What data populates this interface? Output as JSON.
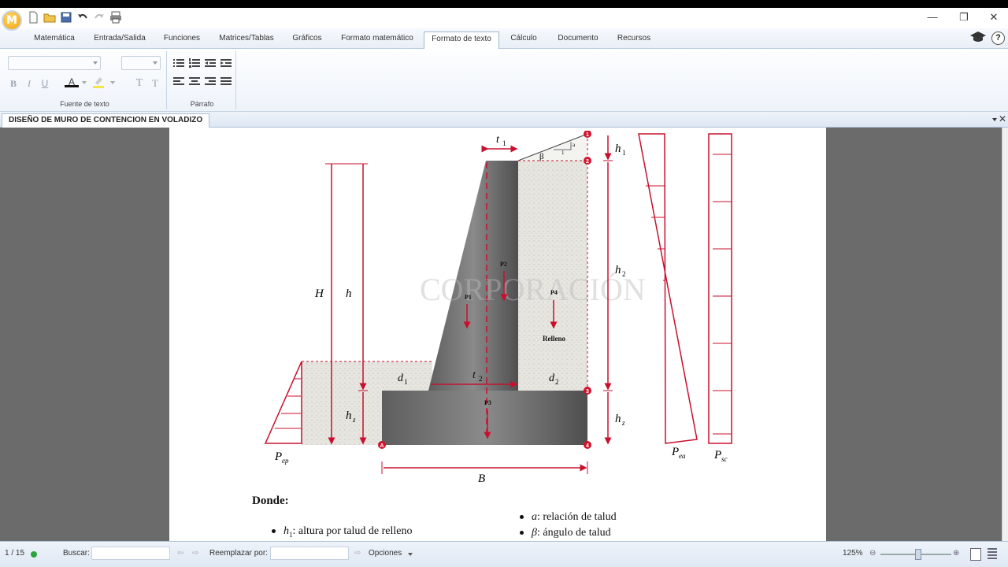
{
  "app": {
    "logo_letter": "M",
    "window_controls": [
      "—",
      "❐",
      "✕"
    ]
  },
  "ribbon_tabs": [
    {
      "label": "Matemática"
    },
    {
      "label": "Entrada/Salida"
    },
    {
      "label": "Funciones"
    },
    {
      "label": "Matrices/Tablas"
    },
    {
      "label": "Gráficos"
    },
    {
      "label": "Formato matemático"
    },
    {
      "label": "Formato de texto",
      "active": true
    },
    {
      "label": "Cálculo"
    },
    {
      "label": "Documento"
    },
    {
      "label": "Recursos"
    }
  ],
  "ribbon_groups": {
    "font": {
      "label": "Fuente de texto",
      "bold": "B",
      "italic": "I",
      "underline": "U",
      "font_color": "A",
      "t1": "T",
      "t2": "T"
    },
    "paragraph": {
      "label": "Párrafo"
    }
  },
  "help": {
    "question": "?"
  },
  "document": {
    "tab_title": "DISEÑO DE MURO DE CONTENCION EN VOLADIZO",
    "figure": {
      "labels": {
        "t1": "t",
        "t1_sub": "1",
        "t2": "t",
        "t2_sub": "2",
        "beta": "β",
        "slope_a": "a",
        "slope_1": "1",
        "H": "H",
        "h": "h",
        "h1": "h",
        "h1_sub": "1",
        "h2": "h",
        "h2_sub": "2",
        "hz_left": "h",
        "hz_left_sub": "z",
        "hz_right": "h",
        "hz_right_sub": "z",
        "d1": "d",
        "d1_sub": "1",
        "d2": "d",
        "d2_sub": "2",
        "B": "B",
        "P1": "P1",
        "P2": "P2",
        "P3": "P3",
        "P4": "P4",
        "relleno": "Relleno",
        "Pep": "P",
        "Pep_sub": "ep",
        "Pea": "P",
        "Pea_sub": "ea",
        "Psc": "P",
        "Psc_sub": "sc",
        "node1": "1",
        "node2": "2",
        "node3": "3",
        "node4": "4",
        "nodeA": "A"
      },
      "colors": {
        "dimension": "#c8102e",
        "concrete": "#555555",
        "soil": "#e4e4e0"
      }
    },
    "donde": "Donde:",
    "bullets": [
      {
        "symbol": "h",
        "sub": "1",
        "text": ": altura por talud de relleno"
      },
      {
        "symbol": "a",
        "sub": "",
        "text": ": relación de talud"
      },
      {
        "symbol": "β",
        "sub": "",
        "text": ": ángulo de talud"
      }
    ]
  },
  "statusbar": {
    "page": "1 / 15",
    "find_label": "Buscar:",
    "replace_label": "Reemplazar por:",
    "options_label": "Opciones",
    "zoom": "125%"
  }
}
